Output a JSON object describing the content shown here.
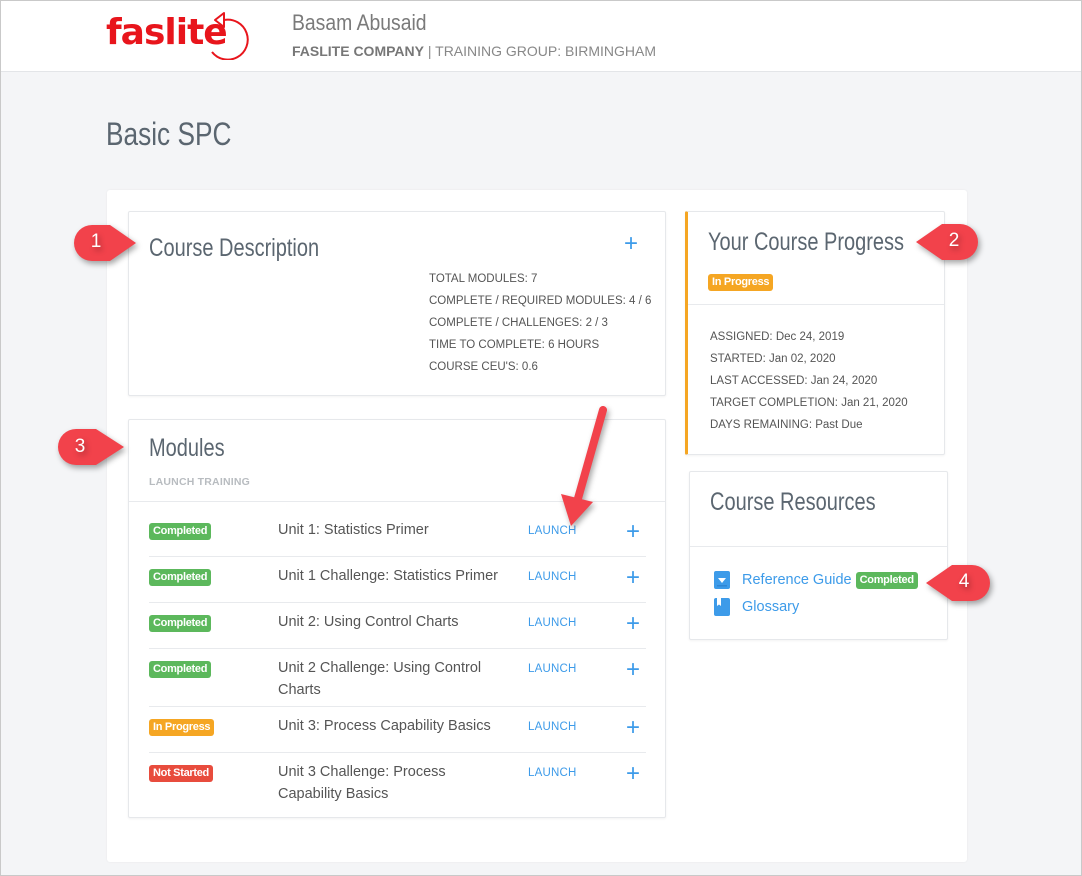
{
  "header": {
    "logo_text": "faslite",
    "user_name": "Basam Abusaid",
    "company": "FASLITE COMPANY",
    "group_separator": " | ",
    "group": "TRAINING GROUP: BIRMINGHAM"
  },
  "page": {
    "title": "Basic SPC"
  },
  "course_description": {
    "title": "Course Description",
    "expand_icon": "plus-icon",
    "stats": [
      "TOTAL MODULES: 7",
      "COMPLETE / REQUIRED MODULES: 4 / 6",
      "COMPLETE / CHALLENGES: 2 / 3",
      "TIME TO COMPLETE: 6 HOURS",
      "COURSE CEU'S: 0.6"
    ]
  },
  "course_progress": {
    "title": "Your Course Progress",
    "status": "In Progress",
    "details": [
      "ASSIGNED: Dec 24, 2019",
      "STARTED: Jan 02, 2020",
      "LAST ACCESSED: Jan 24, 2020",
      "TARGET COMPLETION: Jan 21, 2020",
      "DAYS REMAINING: Past Due"
    ]
  },
  "modules": {
    "title": "Modules",
    "subtitle": "LAUNCH TRAINING",
    "launch_label": "LAUNCH",
    "items": [
      {
        "status": "Completed",
        "name": "Unit 1: Statistics Primer"
      },
      {
        "status": "Completed",
        "name": "Unit 1 Challenge: Statistics Primer"
      },
      {
        "status": "Completed",
        "name": "Unit 2: Using Control Charts"
      },
      {
        "status": "Completed",
        "name": "Unit 2 Challenge: Using Control Charts"
      },
      {
        "status": "In Progress",
        "name": "Unit 3: Process Capability Basics"
      },
      {
        "status": "Not Started",
        "name": "Unit 3 Challenge: Process Capability Basics"
      }
    ]
  },
  "resources": {
    "title": "Course Resources",
    "items": [
      {
        "label": "Reference Guide",
        "icon": "download-icon",
        "status": "Completed"
      },
      {
        "label": "Glossary",
        "icon": "bookmark-icon"
      }
    ]
  },
  "callouts": [
    "1",
    "2",
    "3",
    "4"
  ],
  "colors": {
    "accent": "#3d9be9",
    "completed": "#5cb85c",
    "in_progress": "#f5a623",
    "not_started": "#e84c3d",
    "brand_red": "#e8151c",
    "callout_red": "#f2424b"
  }
}
